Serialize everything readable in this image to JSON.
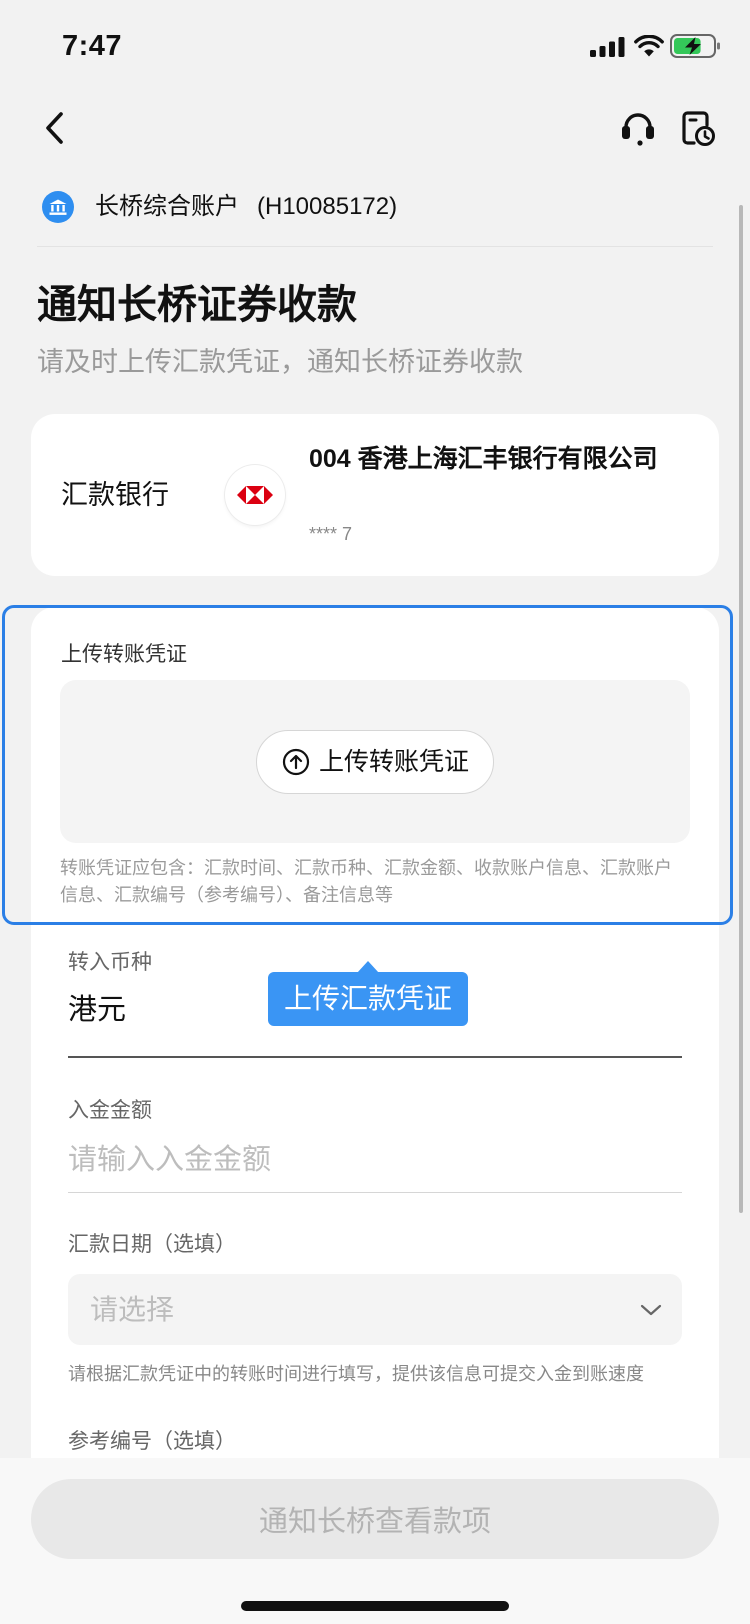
{
  "status_bar": {
    "time": "7:47",
    "signal_icon": "cellular-signal-icon",
    "wifi_icon": "wifi-icon",
    "battery_icon": "battery-charging-icon",
    "battery_level": 0.7
  },
  "nav": {
    "back_icon": "chevron-left-icon",
    "support_icon": "headset-icon",
    "records_icon": "document-clock-icon"
  },
  "account": {
    "icon": "bank-icon",
    "name": "长桥综合账户",
    "number": "(H10085172)"
  },
  "header": {
    "title": "通知长桥证券收款",
    "subtitle": "请及时上传汇款凭证，通知长桥证券收款"
  },
  "remit_bank": {
    "label": "汇款银行",
    "logo": "hsbc-logo-icon",
    "bank_name": "004 香港上海汇丰银行有限公司",
    "account_mask": "**** 7"
  },
  "upload": {
    "label": "上传转账凭证",
    "button_icon": "upload-circle-icon",
    "button_label": "上传转账凭证",
    "note": "转账凭证应包含：汇款时间、汇款币种、汇款金额、收款账户信息、汇款账户信息、汇款编号（参考编号）、备注信息等"
  },
  "tooltip": {
    "text": "上传汇款凭证"
  },
  "form": {
    "currency": {
      "label": "转入币种",
      "value": "港元"
    },
    "amount": {
      "label": "入金金额",
      "placeholder": "请输入入金金额"
    },
    "date": {
      "label": "汇款日期（选填）",
      "placeholder": "请选择",
      "dropdown_icon": "chevron-down-icon",
      "hint": "请根据汇款凭证中的转账时间进行填写，提供该信息可提交入金到账速度"
    },
    "reference": {
      "label": "参考编号（选填）"
    }
  },
  "footer": {
    "submit_label": "通知长桥查看款项"
  },
  "colors": {
    "highlight": "#2b7fe6",
    "tooltip": "#3a95f4",
    "bank_icon": "#2e8ef0",
    "hsbc_red": "#db0011",
    "battery_fill": "#34c759"
  }
}
